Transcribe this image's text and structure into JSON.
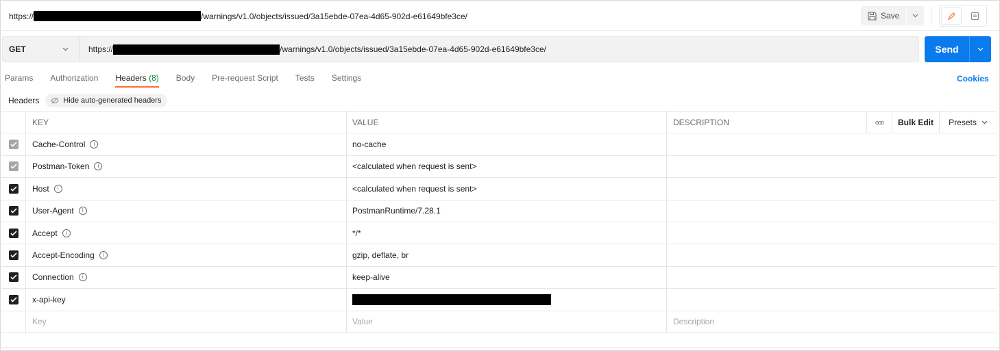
{
  "title": {
    "url_prefix": "https://",
    "url_suffix": "/warnings/v1.0/objects/issued/3a15ebde-07ea-4d65-902d-e61649bfe3ce/",
    "save_label": "Save"
  },
  "request": {
    "method": "GET",
    "url_prefix": "https://",
    "url_suffix": "/warnings/v1.0/objects/issued/3a15ebde-07ea-4d65-902d-e61649bfe3ce/",
    "send_label": "Send"
  },
  "tabs": {
    "params": "Params",
    "authorization": "Authorization",
    "headers": "Headers",
    "headers_count": "(8)",
    "body": "Body",
    "prerequest": "Pre-request Script",
    "tests": "Tests",
    "settings": "Settings",
    "cookies": "Cookies"
  },
  "subhead": {
    "label": "Headers",
    "toggle_label": "Hide auto-generated headers"
  },
  "table": {
    "col_key": "KEY",
    "col_value": "VALUE",
    "col_description": "DESCRIPTION",
    "more": "ooo",
    "bulk_edit": "Bulk Edit",
    "presets": "Presets",
    "rows": [
      {
        "key": "Cache-Control",
        "value": "no-cache"
      },
      {
        "key": "Postman-Token",
        "value": "<calculated when request is sent>"
      },
      {
        "key": "Host",
        "value": "<calculated when request is sent>"
      },
      {
        "key": "User-Agent",
        "value": "PostmanRuntime/7.28.1"
      },
      {
        "key": "Accept",
        "value": "*/*"
      },
      {
        "key": "Accept-Encoding",
        "value": "gzip, deflate, br"
      },
      {
        "key": "Connection",
        "value": "keep-alive"
      },
      {
        "key": "x-api-key",
        "value": ""
      }
    ],
    "placeholder_key": "Key",
    "placeholder_value": "Value",
    "placeholder_description": "Description"
  },
  "info_glyph": "i"
}
